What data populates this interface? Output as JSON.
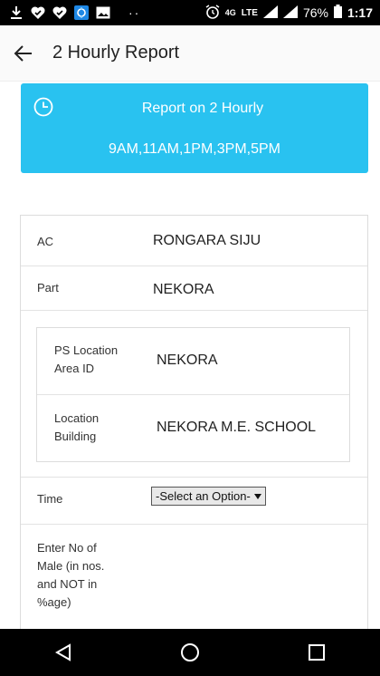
{
  "status_bar": {
    "network": "4G",
    "lte": "LTE",
    "battery": "76%",
    "time": "1:17",
    "dots": "··"
  },
  "app_bar": {
    "title": "2 Hourly Report"
  },
  "banner": {
    "title": "Report on 2 Hourly",
    "times": "9AM,11AM,1PM,3PM,5PM",
    "color": "#29c2f0"
  },
  "form": {
    "ac": {
      "label": "AC",
      "value": "RONGARA SIJU"
    },
    "part": {
      "label": "Part",
      "value": "NEKORA"
    },
    "ps_location": {
      "label_line1": "PS Location",
      "label_line2": "Area ID",
      "value": "NEKORA"
    },
    "location_building": {
      "label_line1": "Location",
      "label_line2": "Building",
      "value": "NEKORA M.E. SCHOOL"
    },
    "time": {
      "label": "Time",
      "selected": "-Select an Option-"
    },
    "male": {
      "label_line1": "Enter No of",
      "label_line2": "Male (in nos.",
      "label_line3": "and NOT in",
      "label_line4": "%age)"
    }
  }
}
